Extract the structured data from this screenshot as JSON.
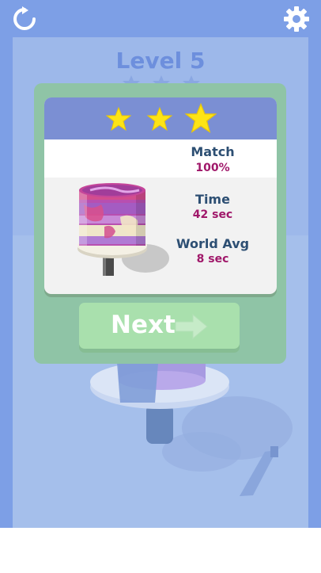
{
  "header": {
    "restart_icon": "restart-icon",
    "settings_icon": "gear-icon",
    "level_title": "Level 5",
    "level_stars_earned": 3
  },
  "result": {
    "stars_earned": 3,
    "stars_total": 3,
    "match_label": "Match",
    "match_value": "100%",
    "time_label": "Time",
    "time_value": "42 sec",
    "world_avg_label": "World Avg",
    "world_avg_value": "8 sec",
    "next_label": "Next",
    "next_icon": "arrow-right-icon"
  },
  "colors": {
    "background": "#7d9fe6",
    "panel": "#8fc4a6",
    "card_header": "#7b8fd3",
    "star": "#fde415",
    "label": "#2d4f73",
    "value": "#a0186a",
    "next_button": "#a9e0ad"
  }
}
